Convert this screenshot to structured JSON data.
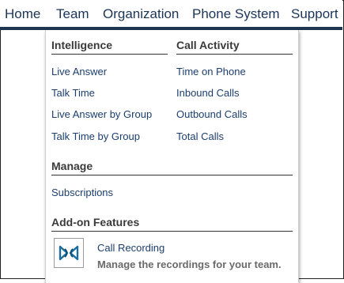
{
  "nav": {
    "items": [
      "Home",
      "Team",
      "Organization",
      "Phone System",
      "Support"
    ]
  },
  "menu": {
    "intelligence": {
      "title": "Intelligence",
      "links": [
        "Live Answer",
        "Talk Time",
        "Live Answer by Group",
        "Talk Time by Group"
      ]
    },
    "call_activity": {
      "title": "Call Activity",
      "links": [
        "Time on Phone",
        "Inbound Calls",
        "Outbound Calls",
        "Total Calls"
      ]
    },
    "manage": {
      "title": "Manage",
      "links": [
        "Subscriptions"
      ]
    },
    "addons": {
      "title": "Add-on Features",
      "feature_title": "Call Recording",
      "feature_desc": "Manage the recordings for your team.",
      "icon": "call-recording-icon"
    }
  },
  "colors": {
    "nav_text": "#1b3557",
    "nav_bar": "#1f3552",
    "link": "#1b3e6e",
    "icon": "#1a6fa0"
  }
}
